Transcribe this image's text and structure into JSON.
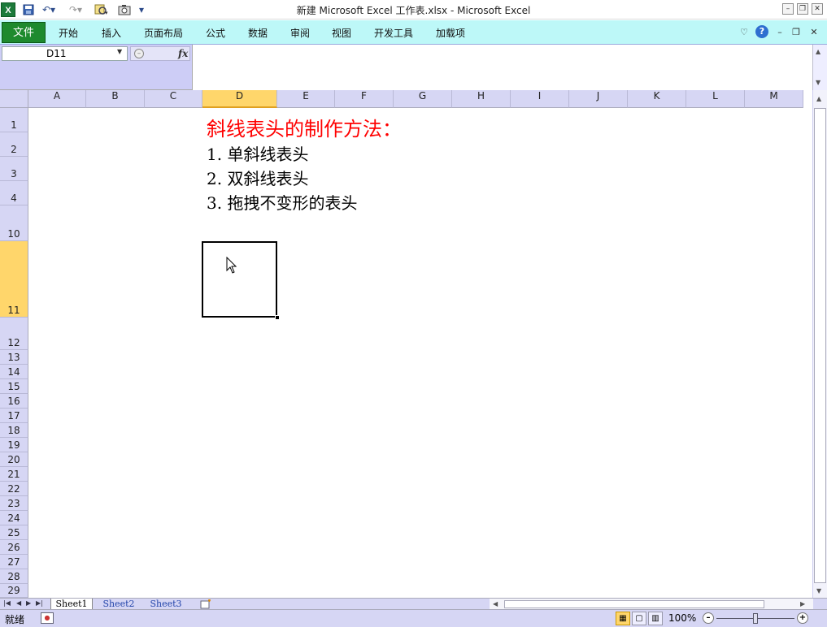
{
  "window": {
    "title": "新建 Microsoft Excel 工作表.xlsx  -  Microsoft Excel"
  },
  "ribbon": {
    "file_tab": "文件",
    "tabs": [
      {
        "label": "开始"
      },
      {
        "label": "插入"
      },
      {
        "label": "页面布局"
      },
      {
        "label": "公式"
      },
      {
        "label": "数据"
      },
      {
        "label": "审阅"
      },
      {
        "label": "视图"
      },
      {
        "label": "开发工具"
      },
      {
        "label": "加载项"
      }
    ]
  },
  "formula_bar": {
    "name_box": "D11",
    "fx_label": "fx",
    "formula_value": ""
  },
  "grid": {
    "columns": [
      "A",
      "B",
      "C",
      "D",
      "E",
      "F",
      "G",
      "H",
      "I",
      "J",
      "K",
      "L",
      "M"
    ],
    "selected_column": "D",
    "rows": [
      "1",
      "2",
      "3",
      "4",
      "10",
      "11",
      "12",
      "13",
      "14",
      "15",
      "16",
      "17",
      "18",
      "19",
      "20",
      "21",
      "22",
      "23",
      "24",
      "25",
      "26",
      "27",
      "28",
      "29"
    ],
    "selected_row": "11",
    "cells": {
      "heading": "斜线表头的制作方法：",
      "item1": "1. 单斜线表头",
      "item2": "2. 双斜线表头",
      "item3": "3. 拖拽不变形的表头"
    },
    "heading_color": "#ff0000",
    "selection_color": "#ffd66b"
  },
  "sheets": {
    "tabs": [
      {
        "label": "Sheet1",
        "active": true
      },
      {
        "label": "Sheet2",
        "active": false
      },
      {
        "label": "Sheet3",
        "active": false
      }
    ]
  },
  "status": {
    "ready": "就绪",
    "zoom": "100%"
  }
}
